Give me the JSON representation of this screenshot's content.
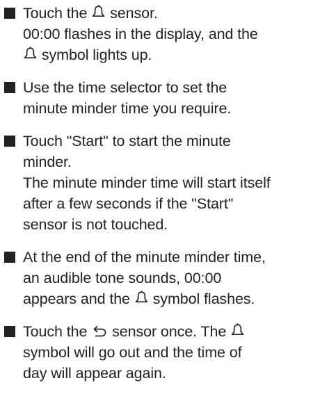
{
  "instructions": [
    {
      "lines": [
        [
          "Touch the ",
          {
            "icon": "bell-icon"
          },
          " sensor."
        ],
        [
          "00:00 flashes in the display, and the"
        ],
        [
          {
            "icon": "bell-icon"
          },
          " symbol lights up."
        ]
      ]
    },
    {
      "lines": [
        [
          "Use the time selector to set the"
        ],
        [
          "minute minder time you require."
        ]
      ]
    },
    {
      "lines": [
        [
          "Touch \"Start\" to start the minute"
        ],
        [
          "minder."
        ],
        [
          "The minute minder time will start itself"
        ],
        [
          "after a few seconds if the \"Start\""
        ],
        [
          "sensor is not touched."
        ]
      ]
    },
    {
      "lines": [
        [
          "At the end of the minute minder time,"
        ],
        [
          "an audible tone sounds, 00:00"
        ],
        [
          "appears and the ",
          {
            "icon": "bell-icon"
          },
          " symbol flashes."
        ]
      ]
    },
    {
      "lines": [
        [
          "Touch the ",
          {
            "icon": "back-arrow-icon"
          },
          " sensor once. The ",
          {
            "icon": "bell-icon"
          }
        ],
        [
          "symbol will go out and the time of"
        ],
        [
          "day will appear again."
        ]
      ]
    }
  ]
}
